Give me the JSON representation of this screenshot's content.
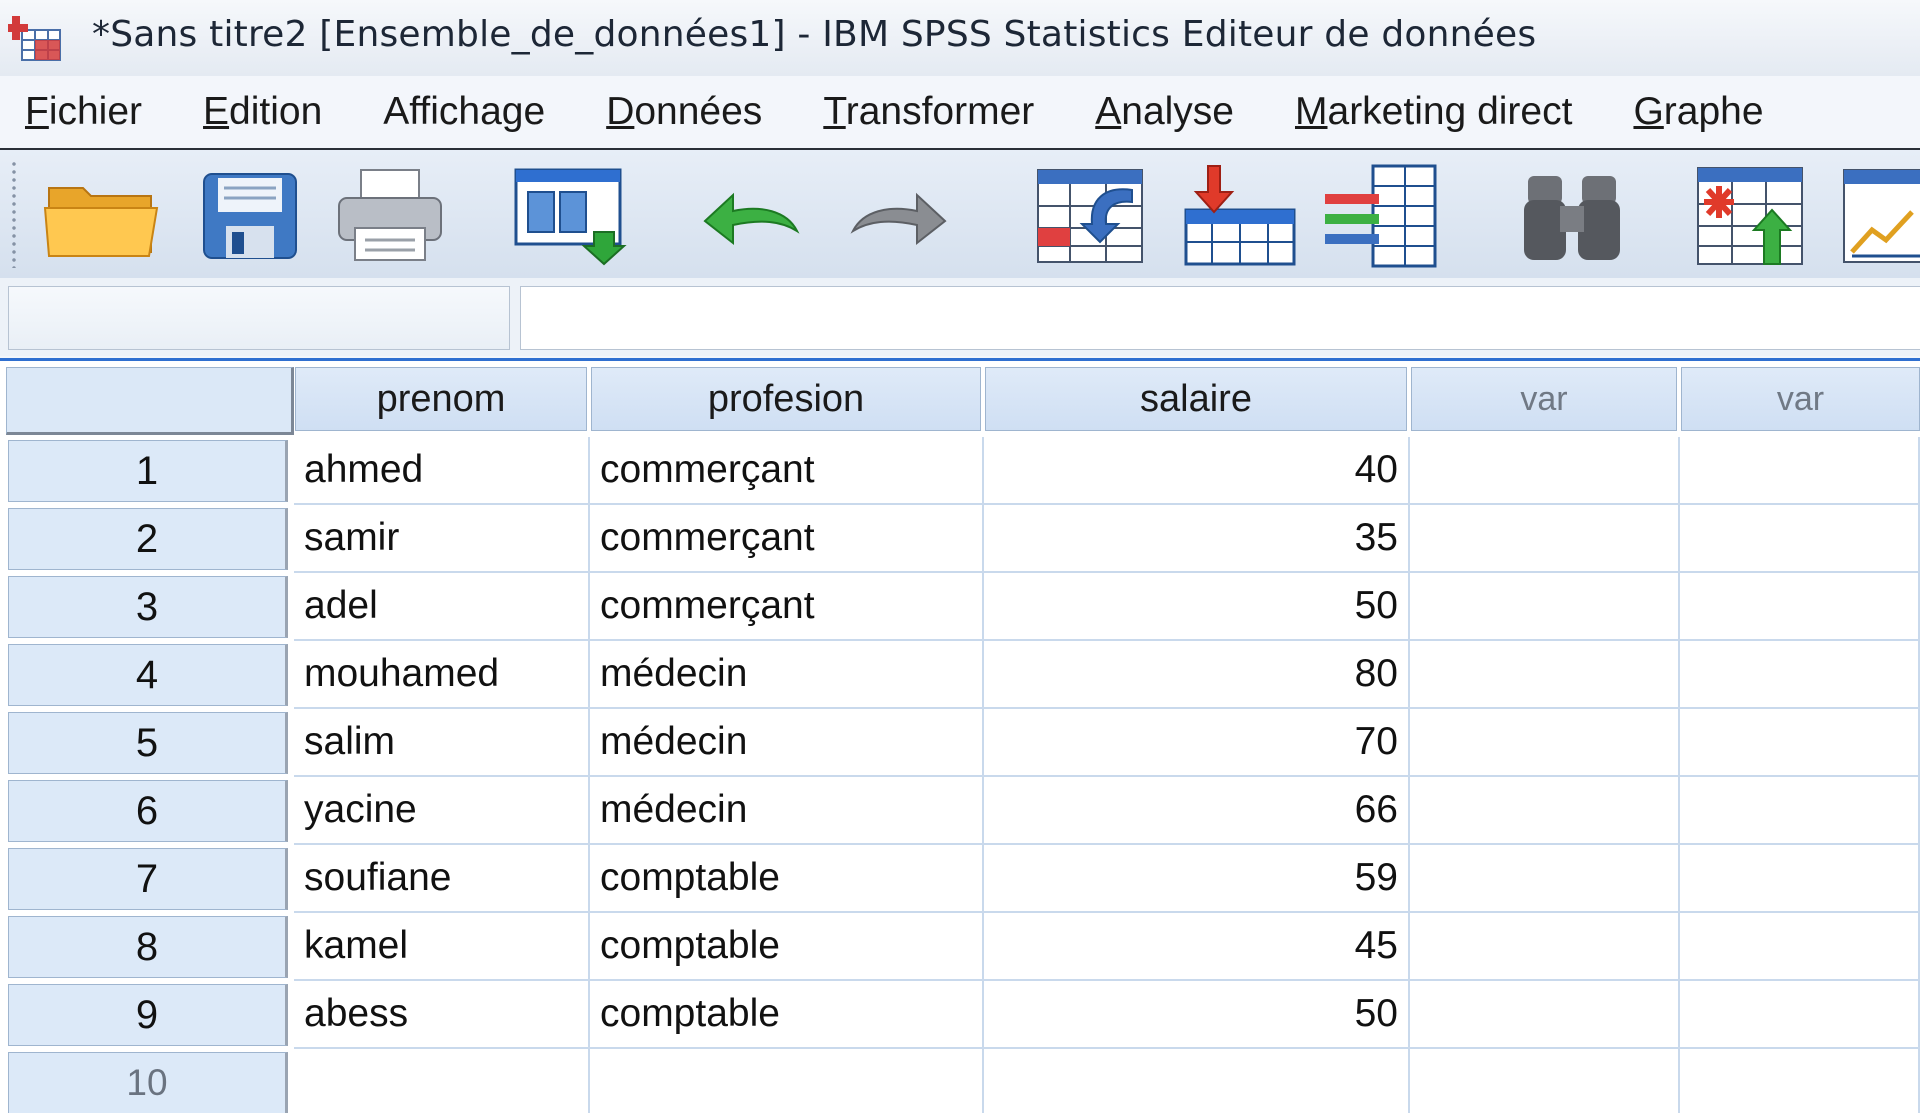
{
  "window": {
    "title": "*Sans titre2 [Ensemble_de_données1] - IBM SPSS Statistics Editeur de données"
  },
  "menu": [
    {
      "label": "Fichier",
      "u": "F",
      "rest": "ichier"
    },
    {
      "label": "Edition",
      "u": "E",
      "rest": "dition"
    },
    {
      "label": "Affichage",
      "u": "",
      "rest": "Affichage"
    },
    {
      "label": "Données",
      "u": "D",
      "rest": "onnées"
    },
    {
      "label": "Transformer",
      "u": "T",
      "rest": "ransformer"
    },
    {
      "label": "Analyse",
      "u": "A",
      "rest": "nalyse"
    },
    {
      "label": "Marketing direct",
      "u": "M",
      "rest": "arketing direct"
    },
    {
      "label": "Graphe",
      "u": "G",
      "rest": "raphe"
    }
  ],
  "toolbar": {
    "icons": [
      "open-folder-icon",
      "save-icon",
      "print-icon",
      "dialog-recall-icon",
      "undo-icon",
      "redo-icon",
      "goto-case-icon",
      "goto-variable-icon",
      "variables-icon",
      "find-icon",
      "insert-cases-icon",
      "chart-icon"
    ]
  },
  "editor": {
    "cell_reference": "",
    "cell_value": ""
  },
  "grid": {
    "columns": [
      "prenom",
      "profesion",
      "salaire",
      "var",
      "var"
    ],
    "rows": [
      {
        "n": "1",
        "prenom": "ahmed",
        "profesion": "commerçant",
        "salaire": "40"
      },
      {
        "n": "2",
        "prenom": "samir",
        "profesion": "commerçant",
        "salaire": "35"
      },
      {
        "n": "3",
        "prenom": "adel",
        "profesion": "commerçant",
        "salaire": "50"
      },
      {
        "n": "4",
        "prenom": "mouhamed",
        "profesion": "médecin",
        "salaire": "80"
      },
      {
        "n": "5",
        "prenom": "salim",
        "profesion": "médecin",
        "salaire": "70"
      },
      {
        "n": "6",
        "prenom": "yacine",
        "profesion": "médecin",
        "salaire": "66"
      },
      {
        "n": "7",
        "prenom": "soufiane",
        "profesion": "comptable",
        "salaire": "59"
      },
      {
        "n": "8",
        "prenom": "kamel",
        "profesion": "comptable",
        "salaire": "45"
      },
      {
        "n": "9",
        "prenom": "abess",
        "profesion": "comptable",
        "salaire": "50"
      },
      {
        "n": "10",
        "prenom": "",
        "profesion": "",
        "salaire": ""
      }
    ]
  },
  "colors": {
    "header_bg": "#dce9f8",
    "grid_line": "#c9d9ec",
    "accent": "#2f6fd0"
  }
}
